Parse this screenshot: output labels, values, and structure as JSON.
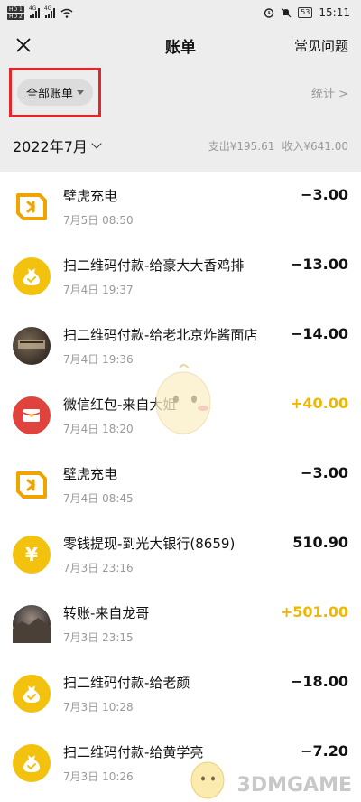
{
  "status_bar": {
    "hd1": "HD 1",
    "hd2": "HD 2",
    "network": "4G",
    "battery": "53",
    "time": "15:11"
  },
  "nav": {
    "close_icon": "close-icon",
    "title": "账单",
    "faq": "常见问题"
  },
  "filter": {
    "label": "全部账单",
    "stats": "统计 >"
  },
  "month": {
    "label": "2022年7月",
    "expense": "支出¥195.61",
    "income": "收入¥641.00"
  },
  "rows": [
    {
      "title": "壁虎充电",
      "time": "7月5日 08:50",
      "amount": "−3.00",
      "type": "expense",
      "icon": "charge"
    },
    {
      "title": "扫二维码付款-给豪大大香鸡排",
      "time": "7月4日 19:37",
      "amount": "−13.00",
      "type": "expense",
      "icon": "money"
    },
    {
      "title": "扫二维码付款-给老北京炸酱面店",
      "time": "7月4日 19:36",
      "amount": "−14.00",
      "type": "expense",
      "icon": "photo1"
    },
    {
      "title": "微信红包-来自大姐",
      "time": "7月4日 18:20",
      "amount": "+40.00",
      "type": "income",
      "icon": "red"
    },
    {
      "title": "壁虎充电",
      "time": "7月4日 08:45",
      "amount": "−3.00",
      "type": "expense",
      "icon": "charge"
    },
    {
      "title": "零钱提现-到光大银行(8659)",
      "time": "7月3日 23:16",
      "amount": "510.90",
      "type": "neutral",
      "icon": "yen"
    },
    {
      "title": "转账-来自龙哥",
      "time": "7月3日 23:15",
      "amount": "+501.00",
      "type": "income",
      "icon": "photo2"
    },
    {
      "title": "扫二维码付款-给老颜",
      "time": "7月3日 10:28",
      "amount": "−18.00",
      "type": "expense",
      "icon": "money"
    },
    {
      "title": "扫二维码付款-给黄学亮",
      "time": "7月3日 10:26",
      "amount": "−7.20",
      "type": "expense",
      "icon": "money"
    }
  ],
  "watermark": "3DMGAME",
  "colors": {
    "income": "#f0b700",
    "highlight": "#e4262a",
    "yellow_icon": "#f2c20f",
    "red_packet": "#e0433d"
  }
}
